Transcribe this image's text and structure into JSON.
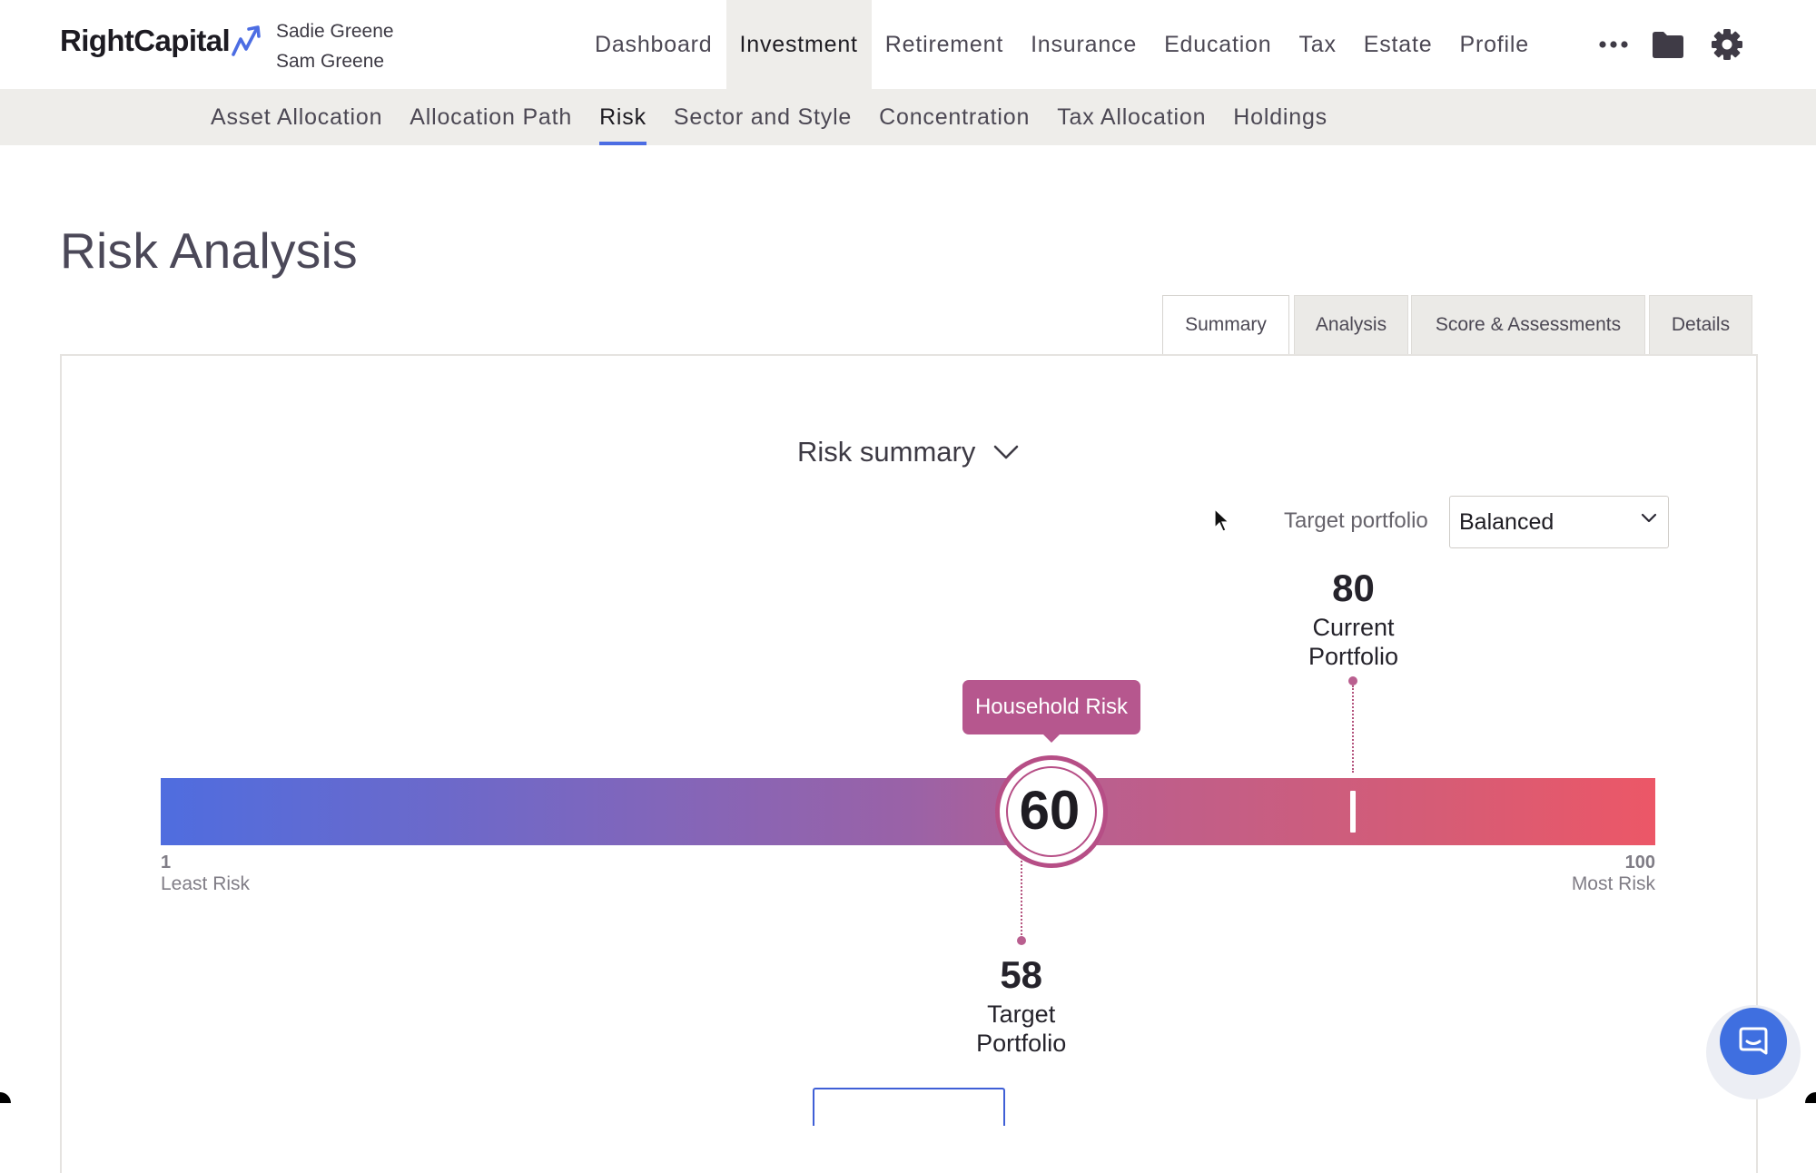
{
  "brand": {
    "name": "RightCapital",
    "accent": "#4c6de3"
  },
  "clients": [
    "Sadie Greene",
    "Sam Greene"
  ],
  "main_nav": [
    {
      "label": "Dashboard"
    },
    {
      "label": "Investment",
      "active": true
    },
    {
      "label": "Retirement"
    },
    {
      "label": "Insurance"
    },
    {
      "label": "Education"
    },
    {
      "label": "Tax"
    },
    {
      "label": "Estate"
    },
    {
      "label": "Profile"
    }
  ],
  "toolbar_icons": [
    "more-dots-icon",
    "folder-icon",
    "gear-icon"
  ],
  "sub_nav": [
    {
      "label": "Asset Allocation"
    },
    {
      "label": "Allocation Path"
    },
    {
      "label": "Risk",
      "active": true
    },
    {
      "label": "Sector and Style"
    },
    {
      "label": "Concentration"
    },
    {
      "label": "Tax Allocation"
    },
    {
      "label": "Holdings"
    }
  ],
  "page": {
    "title": "Risk Analysis"
  },
  "tabs": [
    {
      "label": "Summary",
      "active": true
    },
    {
      "label": "Analysis"
    },
    {
      "label": "Score & Assessments"
    },
    {
      "label": "Details"
    }
  ],
  "summary": {
    "dropdown_label": "Risk summary",
    "target_portfolio_label": "Target portfolio",
    "target_portfolio_value": "Balanced"
  },
  "gauge": {
    "min": 1,
    "max": 100,
    "min_label": "Least Risk",
    "max_label": "Most Risk",
    "household": {
      "value": 60,
      "tooltip": "Household Risk",
      "color": "#b64e86"
    },
    "current": {
      "value": 80,
      "label_line1": "Current",
      "label_line2": "Portfolio"
    },
    "target": {
      "value": 58,
      "label_line1": "Target",
      "label_line2": "Portfolio"
    },
    "gradient_colors": [
      "#4f6ddf",
      "#9a62a7",
      "#ec5767"
    ]
  },
  "chat": {
    "icon": "chat-icon",
    "color": "#3f6fe0"
  }
}
